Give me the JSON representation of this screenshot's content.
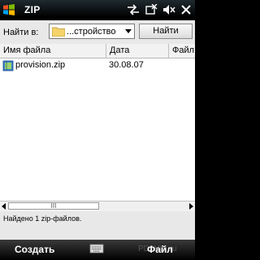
{
  "titlebar": {
    "title": "ZIP"
  },
  "search": {
    "label": "Найти в:",
    "location": "...стройство",
    "find_button": "Найти"
  },
  "columns": [
    "Имя файла",
    "Дата",
    "Файл"
  ],
  "files": [
    {
      "name": "provision.zip",
      "date": "30.08.07"
    }
  ],
  "scrollbar": {
    "thumb_grip": "III"
  },
  "status": {
    "text": "Найдено 1 zip-файлов."
  },
  "softkeys": {
    "left": "Создать",
    "right": "Файл"
  },
  "watermark": "PDAVIK.ru"
}
